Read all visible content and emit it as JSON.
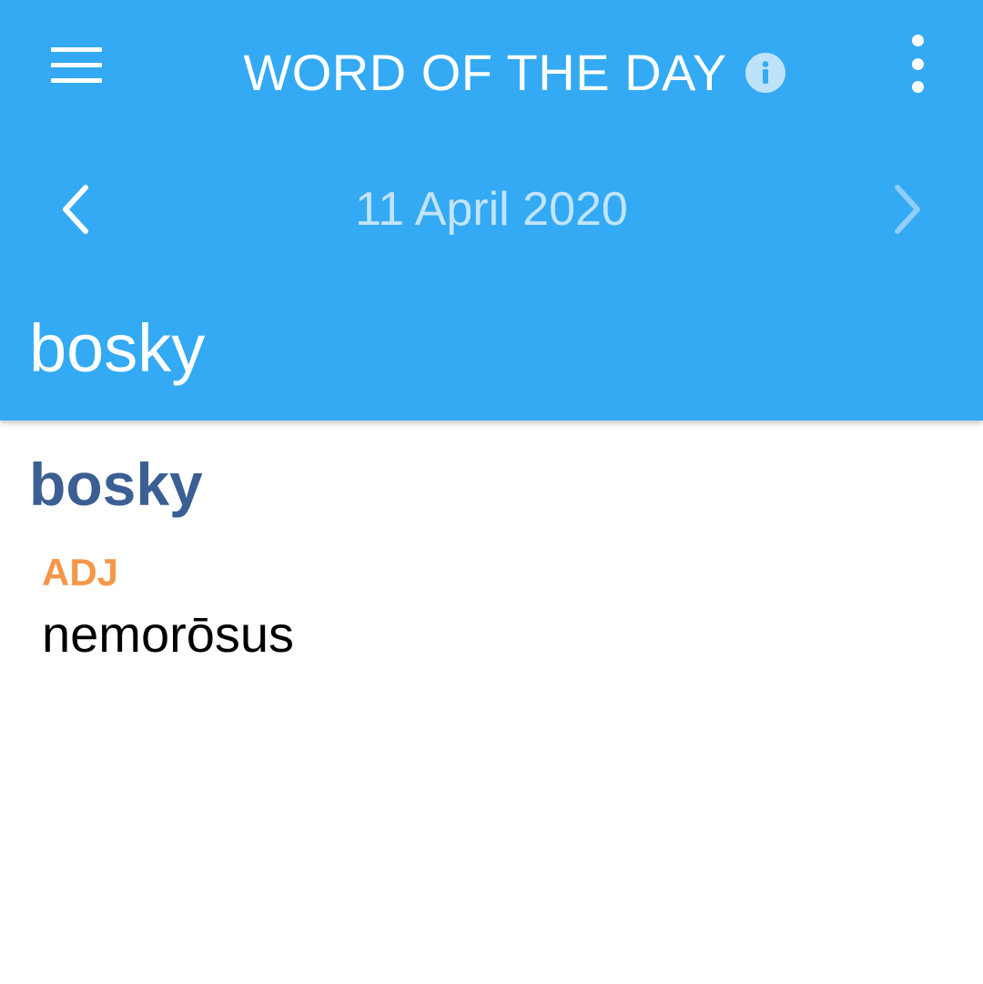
{
  "header": {
    "title": "WORD OF THE DAY",
    "date": "11 April 2020",
    "word": "bosky",
    "icons": {
      "menu": "hamburger-menu-icon",
      "info": "info-icon",
      "more": "more-vert-icon",
      "prev": "chevron-left-icon",
      "next": "chevron-right-icon"
    }
  },
  "entry": {
    "word": "bosky",
    "part_of_speech": "ADJ",
    "translation": "nemorōsus"
  },
  "colors": {
    "header_bg": "#33aaf3",
    "entry_word": "#3b5f93",
    "part_of_speech": "#f5974a",
    "date_text": "#c2e4fb"
  }
}
